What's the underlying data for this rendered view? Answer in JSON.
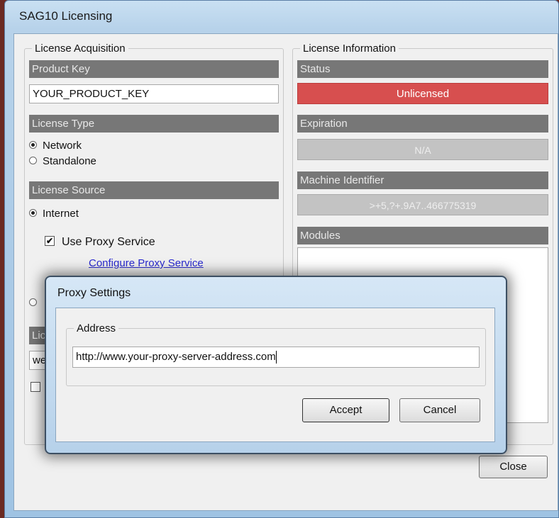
{
  "window": {
    "title": "SAG10 Licensing"
  },
  "acquisition": {
    "legend": "License Acquisition",
    "product_key_header": "Product Key",
    "product_key_value": "YOUR_PRODUCT_KEY",
    "license_type_header": "License Type",
    "type_network": "Network",
    "type_standalone": "Standalone",
    "license_source_header": "License Source",
    "source_internet": "Internet",
    "use_proxy_label": "Use Proxy Service",
    "configure_proxy_link": "Configure Proxy Service",
    "partial_header": "Lic",
    "partial_field": "we"
  },
  "information": {
    "legend": "License Information",
    "status_header": "Status",
    "status_value": "Unlicensed",
    "expiration_header": "Expiration",
    "expiration_value": "N/A",
    "machine_id_header": "Machine Identifier",
    "machine_id_value": ">+5,?+.9A7..466775319",
    "modules_header": "Modules"
  },
  "close_label": "Close",
  "proxy_dialog": {
    "title": "Proxy Settings",
    "address_legend": "Address",
    "address_value": "http://www.your-proxy-server-address.com",
    "accept_label": "Accept",
    "cancel_label": "Cancel"
  },
  "colors": {
    "status_unlicensed": "#d74f4f",
    "section_header": "#777777"
  }
}
